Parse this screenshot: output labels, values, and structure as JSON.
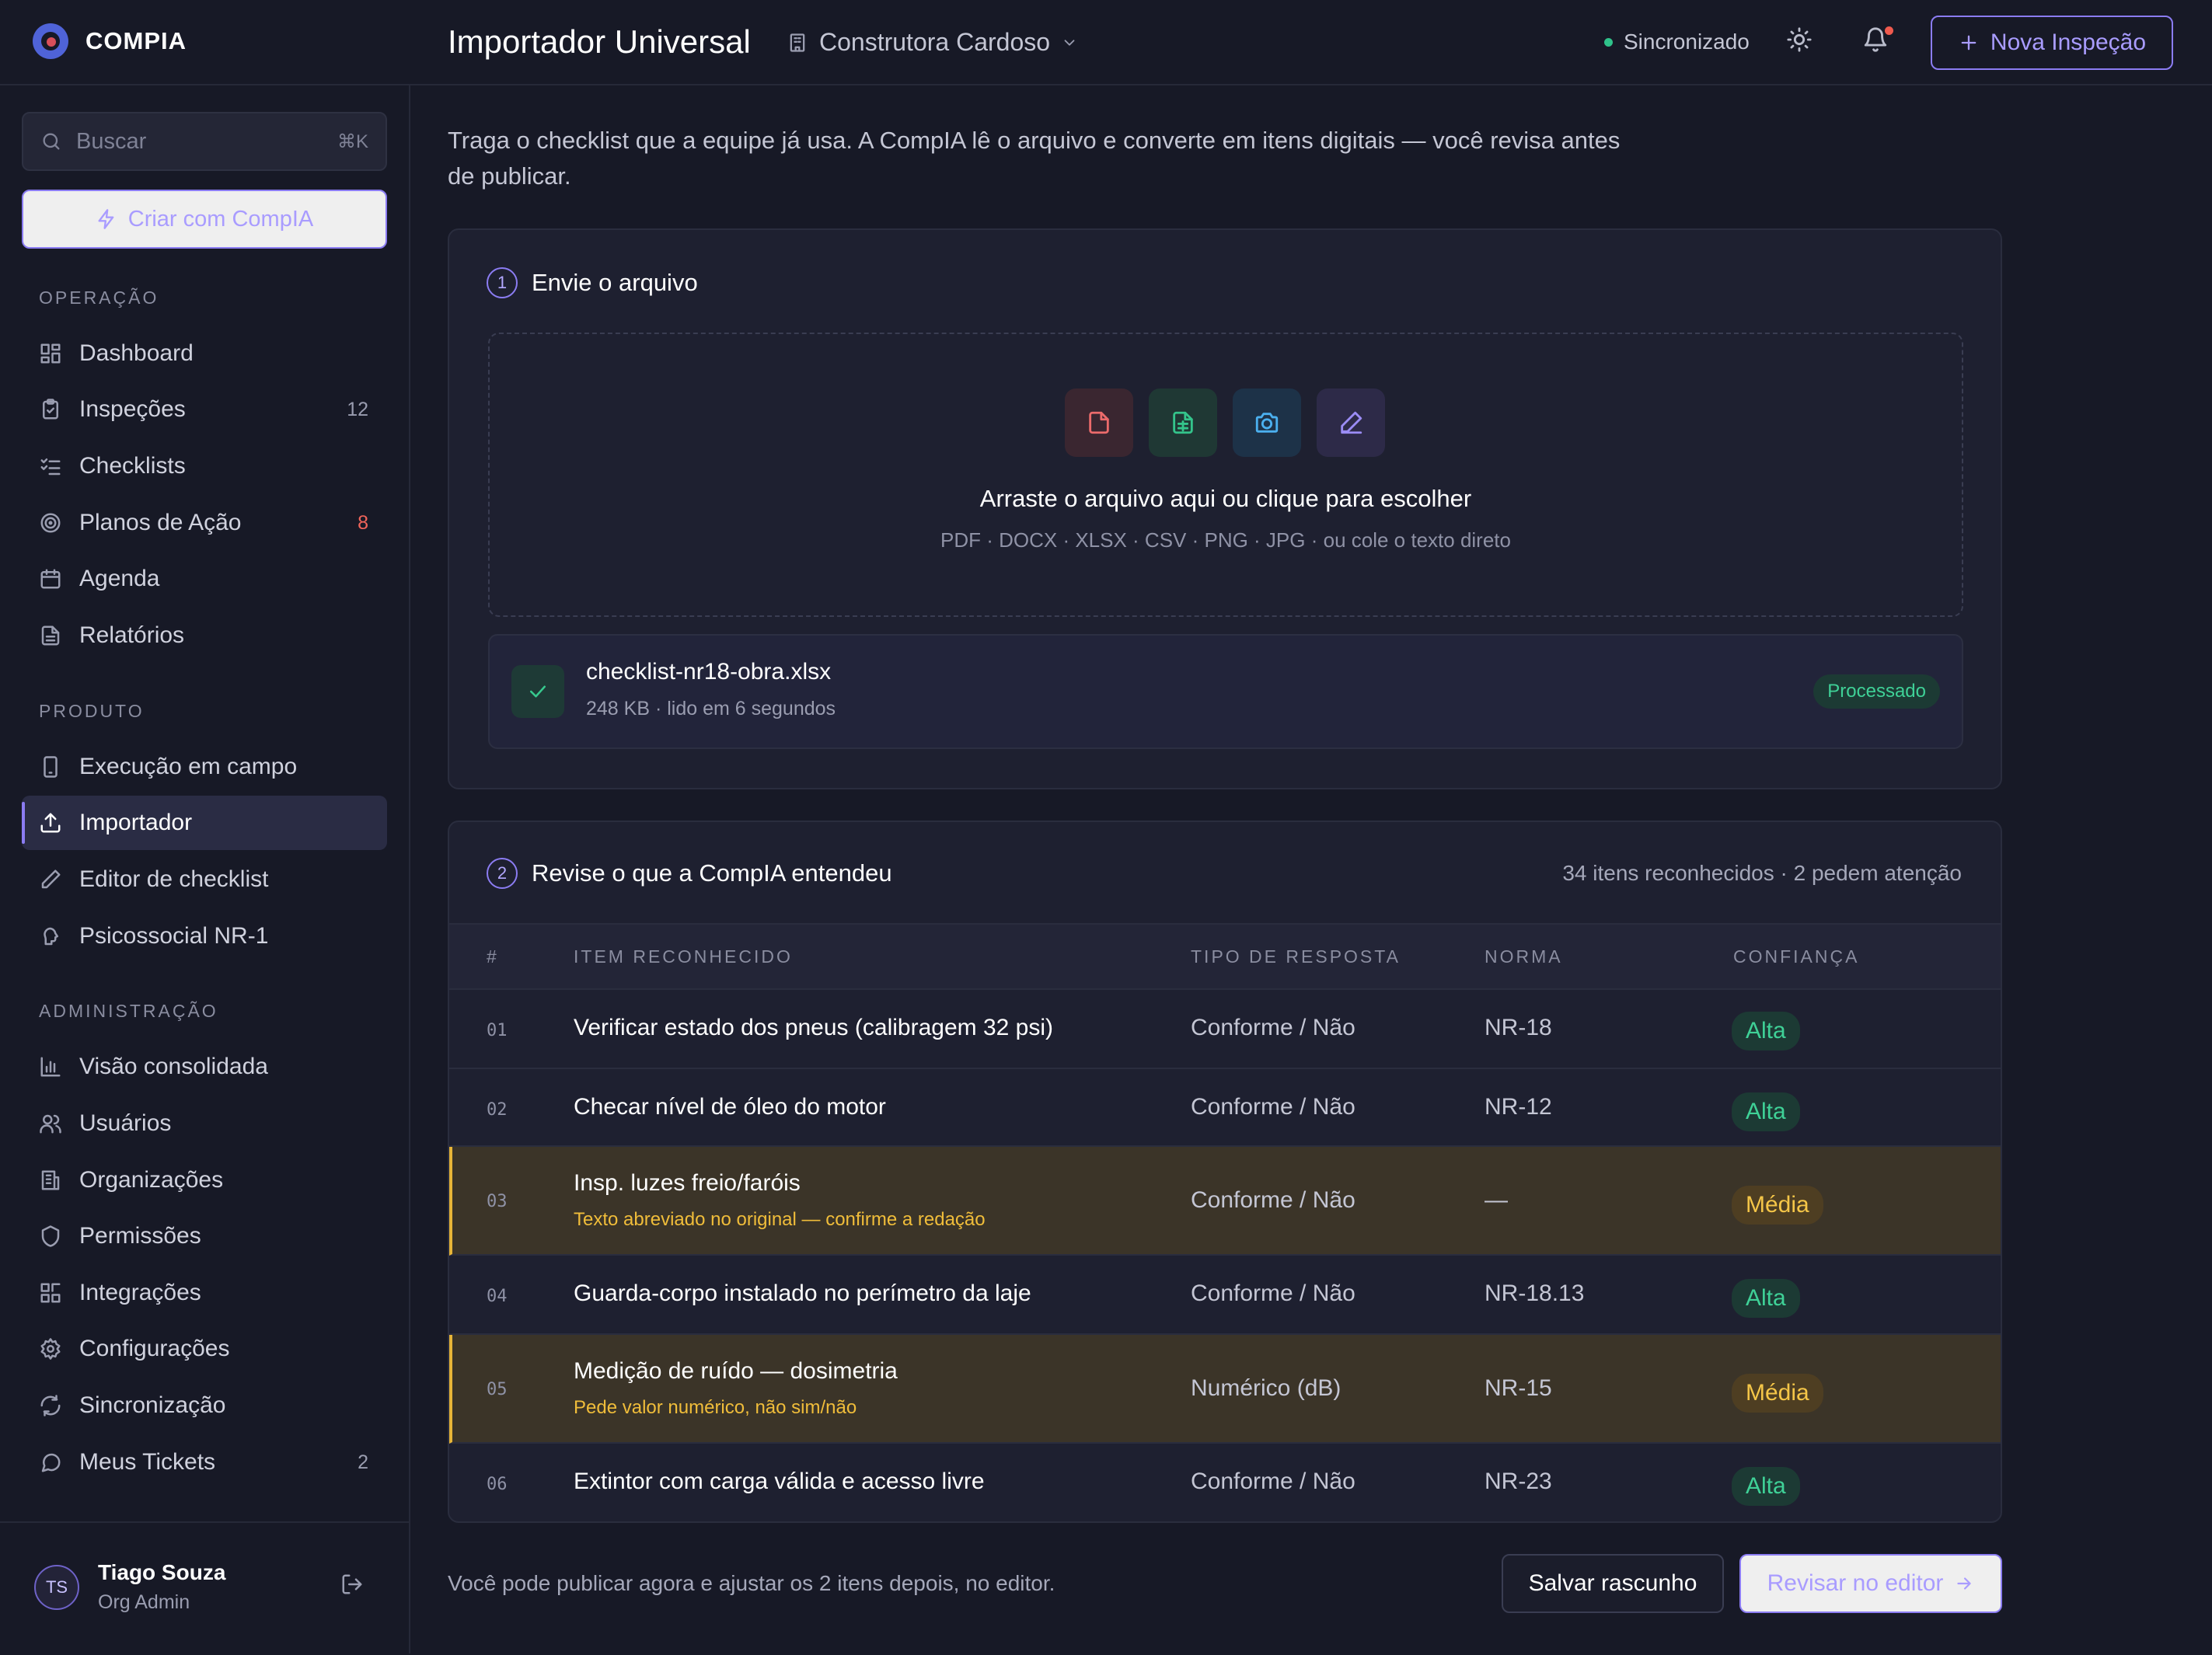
{
  "brand": {
    "name": "COMPIA"
  },
  "header": {
    "title": "Importador Universal",
    "org_selector": "Construtora Cardoso",
    "sync_status": "Sincronizado",
    "new_inspection_label": "Nova Inspeção",
    "accent_color": "#8b7cf2"
  },
  "sidebar": {
    "search_placeholder": "Buscar",
    "search_shortcut": "⌘K",
    "create_label": "Criar com CompIA",
    "sections": [
      {
        "label": "OPERAÇÃO",
        "items": [
          {
            "label": "Dashboard",
            "icon": "grid-icon"
          },
          {
            "label": "Inspeções",
            "icon": "clipboard-icon",
            "count": "12"
          },
          {
            "label": "Checklists",
            "icon": "list-check-icon"
          },
          {
            "label": "Planos de Ação",
            "icon": "target-icon",
            "count": "8"
          },
          {
            "label": "Agenda",
            "icon": "calendar-icon"
          },
          {
            "label": "Relatórios",
            "icon": "file-text-icon"
          }
        ]
      },
      {
        "label": "PRODUTO",
        "items": [
          {
            "label": "Execução em campo",
            "icon": "smartphone-icon"
          },
          {
            "label": "Importador",
            "icon": "upload-icon",
            "active": true
          },
          {
            "label": "Editor de checklist",
            "icon": "pencil-icon"
          },
          {
            "label": "Psicossocial NR-1",
            "icon": "brain-icon"
          }
        ]
      },
      {
        "label": "ADMINISTRAÇÃO",
        "items": [
          {
            "label": "Visão consolidada",
            "icon": "bar-chart-icon"
          },
          {
            "label": "Usuários",
            "icon": "users-icon"
          },
          {
            "label": "Organizações",
            "icon": "building-icon"
          },
          {
            "label": "Permissões",
            "icon": "shield-icon"
          },
          {
            "label": "Integrações",
            "icon": "blocks-icon"
          },
          {
            "label": "Configurações",
            "icon": "gear-icon"
          },
          {
            "label": "Sincronização",
            "icon": "refresh-icon"
          },
          {
            "label": "Meus Tickets",
            "icon": "message-icon",
            "count": "2"
          }
        ]
      }
    ],
    "user": {
      "initials": "TS",
      "name": "Tiago Souza",
      "role": "Org Admin"
    }
  },
  "intro": "Traga o checklist que a equipe já usa. A CompIA lê o arquivo e converte em itens digitais — você revisa antes de publicar.",
  "upload": {
    "step": "1",
    "title": "Envie o arquivo",
    "drop_title": "Arraste o arquivo aqui ou clique para escolher",
    "formats": "PDF · DOCX · XLSX · CSV · PNG · JPG · ou cole o texto direto",
    "file": {
      "name": "checklist-nr18-obra.xlsx",
      "meta": "248 KB · lido em 6 segundos",
      "status": "Processado"
    }
  },
  "review": {
    "step": "2",
    "title": "Revise o que a CompIA entendeu",
    "summary": "34 itens reconhecidos · 2 pedem atenção",
    "columns": [
      "#",
      "ITEM RECONHECIDO",
      "TIPO DE RESPOSTA",
      "NORMA",
      "CONFIANÇA"
    ],
    "rows": [
      {
        "num": "01",
        "item": "Verificar estado dos pneus (calibragem 32 psi)",
        "note": "",
        "type": "Conforme / Não",
        "norm": "NR-18",
        "confidence": "Alta",
        "warn": false
      },
      {
        "num": "02",
        "item": "Checar nível de óleo do motor",
        "note": "",
        "type": "Conforme / Não",
        "norm": "NR-12",
        "confidence": "Alta",
        "warn": false
      },
      {
        "num": "03",
        "item": "Insp. luzes freio/faróis",
        "note": "Texto abreviado no original — confirme a redação",
        "type": "Conforme / Não",
        "norm": "—",
        "confidence": "Média",
        "warn": true
      },
      {
        "num": "04",
        "item": "Guarda-corpo instalado no perímetro da laje",
        "note": "",
        "type": "Conforme / Não",
        "norm": "NR-18.13",
        "confidence": "Alta",
        "warn": false
      },
      {
        "num": "05",
        "item": "Medição de ruído — dosimetria",
        "note": "Pede valor numérico, não sim/não",
        "type": "Numérico (dB)",
        "norm": "NR-15",
        "confidence": "Média",
        "warn": true
      },
      {
        "num": "06",
        "item": "Extintor com carga válida e acesso livre",
        "note": "",
        "type": "Conforme / Não",
        "norm": "NR-23",
        "confidence": "Alta",
        "warn": false
      }
    ]
  },
  "footer": {
    "note": "Você pode publicar agora e ajustar os 2 itens depois, no editor.",
    "save_draft": "Salvar rascunho",
    "review_editor": "Revisar no editor"
  }
}
